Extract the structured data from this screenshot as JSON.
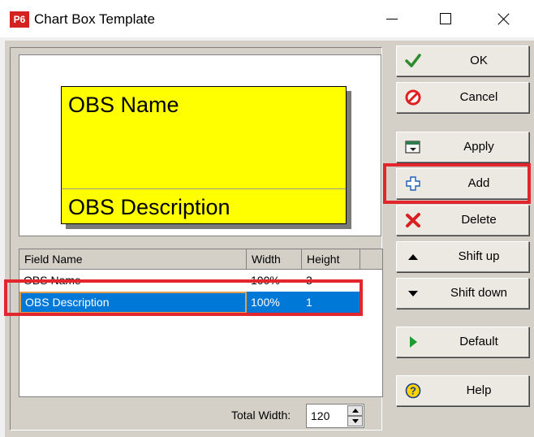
{
  "window": {
    "app_icon_text": "P6",
    "title": "Chart Box Template"
  },
  "preview": {
    "field_1": "OBS Name",
    "field_2": "OBS Description",
    "box_color": "#ffff00"
  },
  "grid": {
    "columns": [
      "Field Name",
      "Width",
      "Height"
    ],
    "rows": [
      {
        "field_name": "OBS Name",
        "width": "100%",
        "height": "3"
      },
      {
        "field_name": "OBS Description",
        "width": "100%",
        "height": "1"
      }
    ],
    "selected_row": 1
  },
  "total_width": {
    "label": "Total Width:",
    "value": "120"
  },
  "buttons": {
    "ok": "OK",
    "cancel": "Cancel",
    "apply": "Apply",
    "add": "Add",
    "delete": "Delete",
    "shift_up": "Shift up",
    "shift_down": "Shift down",
    "default": "Default",
    "help": "Help"
  },
  "colors": {
    "highlight": "#e3262e",
    "selection": "#0078d7",
    "app_icon": "#d42121"
  }
}
